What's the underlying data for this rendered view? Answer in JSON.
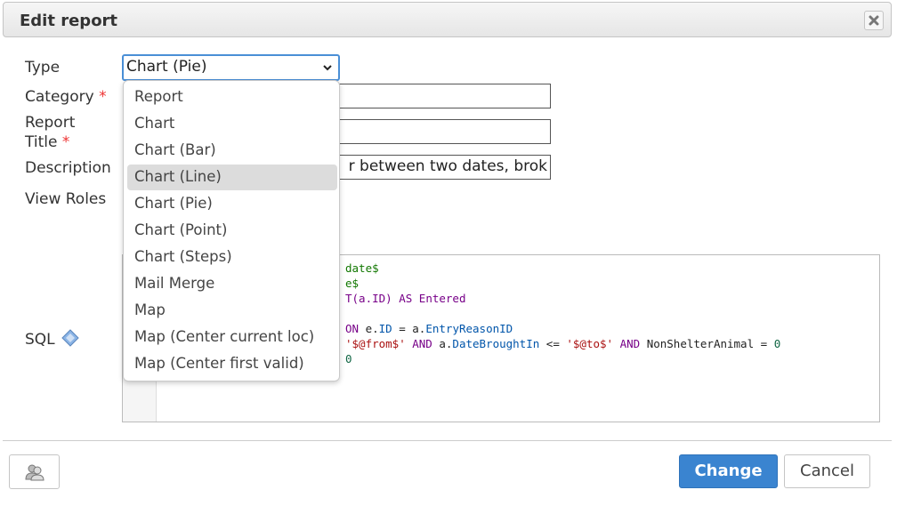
{
  "dialog": {
    "title": "Edit report"
  },
  "labels": {
    "type": "Type",
    "category": "Category",
    "report_title_line1": "Report",
    "report_title_line2": "Title",
    "required_mark": "*",
    "description": "Description",
    "view_roles": "View Roles",
    "sql": "SQL"
  },
  "type_select": {
    "value": "Chart (Pie)"
  },
  "fields": {
    "category": "",
    "title": "",
    "description_visible": "r between two dates, brok"
  },
  "dropdown": {
    "options": [
      "Report",
      "Chart",
      "Chart (Bar)",
      "Chart (Line)",
      "Chart (Pie)",
      "Chart (Point)",
      "Chart (Steps)",
      "Mail Merge",
      "Map",
      "Map (Center current loc)",
      "Map (Center first valid)"
    ],
    "highlighted": "Chart (Line)"
  },
  "sql_visible": {
    "l1": "date$",
    "l2": "e$",
    "l3a": "T",
    "l3b": "(a.ID)",
    "l3c": " AS Entered",
    "l5a": "ON",
    "l5b": " e.",
    "l5c": "ID",
    "l5d": " = a.",
    "l5e": "EntryReasonID",
    "l6a": "'$@from$'",
    "l6b": " AND",
    "l6c": " a.",
    "l6d": "DateBroughtIn",
    "l6e": " <= ",
    "l6f": "'$@to$'",
    "l6g": " AND",
    "l6h": " NonShelterAnimal = ",
    "l6i": "0",
    "l7": "0"
  },
  "buttons": {
    "change": "Change",
    "cancel": "Cancel"
  },
  "icons": {
    "close": "close-icon",
    "help": "help-diamond-icon",
    "user": "users-icon",
    "chevron": "chevron-down-icon"
  }
}
